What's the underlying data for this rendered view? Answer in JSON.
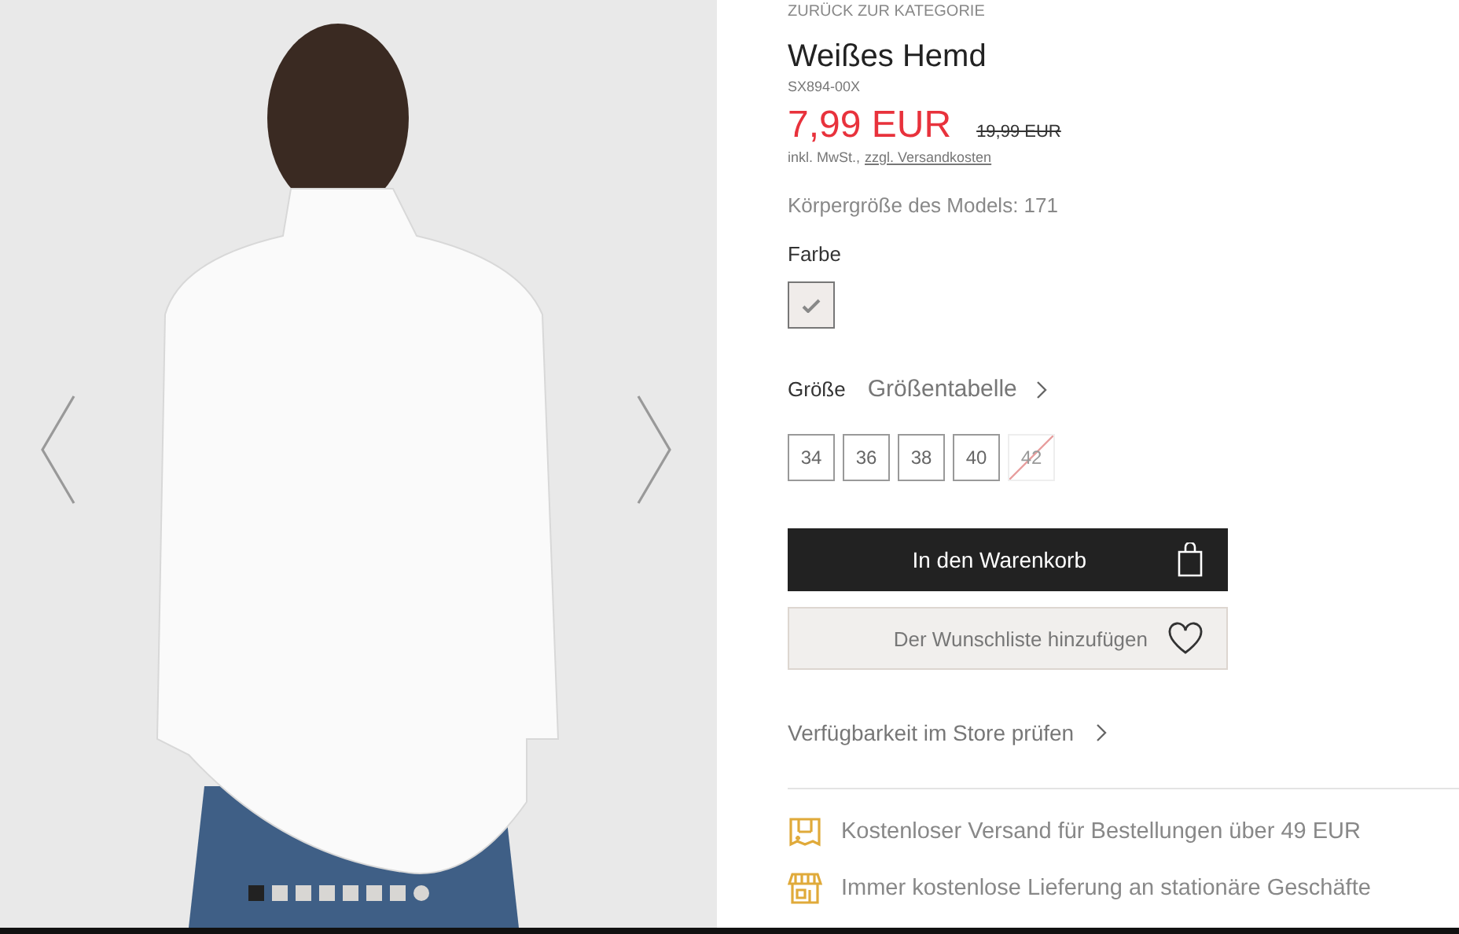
{
  "gallery": {
    "dots": [
      {
        "kind": "image",
        "selected": true
      },
      {
        "kind": "image",
        "selected": false
      },
      {
        "kind": "image",
        "selected": false
      },
      {
        "kind": "image",
        "selected": false
      },
      {
        "kind": "image",
        "selected": false
      },
      {
        "kind": "image",
        "selected": false
      },
      {
        "kind": "image",
        "selected": false
      },
      {
        "kind": "video",
        "selected": false
      }
    ]
  },
  "product": {
    "back_link": "ZURÜCK ZUR KATEGORIE",
    "title": "Weißes Hemd",
    "sku": "SX894-00X",
    "price": "7,99 EUR",
    "old_price": "19,99 EUR",
    "tax_note": "inkl. MwSt.,",
    "shipping_link": "zzgl. Versandkosten",
    "model_height": "Körpergröße des Models: 171"
  },
  "color": {
    "label": "Farbe",
    "swatches": [
      {
        "selected": true,
        "color": "#f0ecea"
      }
    ]
  },
  "size": {
    "label": "Größe",
    "chart_link": "Größentabelle",
    "options": [
      {
        "label": "34",
        "available": true
      },
      {
        "label": "36",
        "available": true
      },
      {
        "label": "38",
        "available": true
      },
      {
        "label": "40",
        "available": true
      },
      {
        "label": "42",
        "available": false
      }
    ]
  },
  "cart_button": "In den Warenkorb",
  "wishlist_button": "Der Wunschliste hinzufügen",
  "store_link": "Verfügbarkeit im Store prüfen",
  "benefits": [
    {
      "kind": "box",
      "text": "Kostenloser Versand für Bestellungen über 49 EUR"
    },
    {
      "kind": "store",
      "text": "Immer kostenlose Lieferung an stationäre Geschäfte"
    }
  ]
}
